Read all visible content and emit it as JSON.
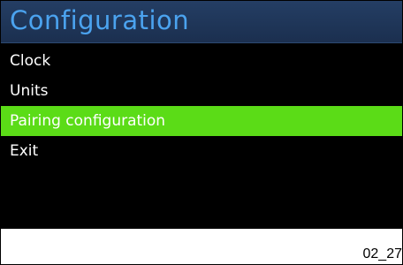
{
  "header": {
    "title": "Configuration"
  },
  "menu": {
    "items": [
      {
        "label": "Clock",
        "selected": false
      },
      {
        "label": "Units",
        "selected": false
      },
      {
        "label": "Pairing configuration",
        "selected": true
      },
      {
        "label": "Exit",
        "selected": false
      }
    ]
  },
  "footer": {
    "code": "02_27"
  },
  "colors": {
    "title_bar": "#1f355a",
    "title_text": "#4ba3ef",
    "selected_background": "#5bdc17",
    "screen_background": "#000000",
    "item_text": "#ffffff"
  }
}
